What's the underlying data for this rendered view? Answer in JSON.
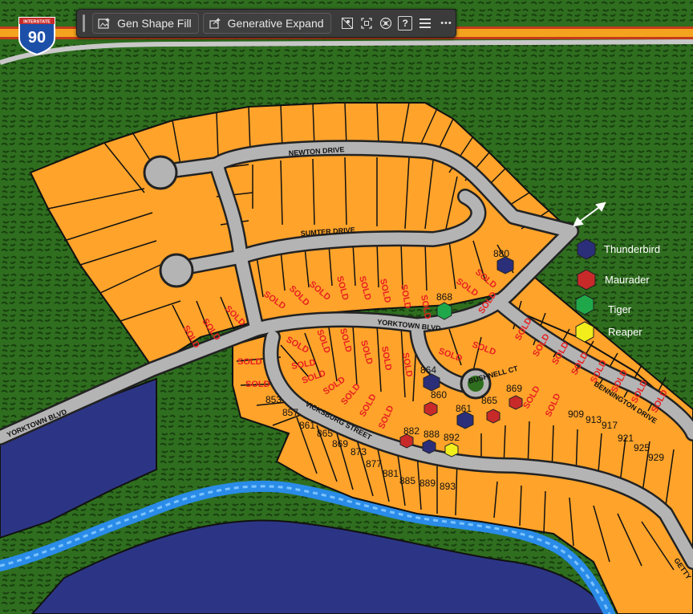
{
  "toolbar": {
    "gen_shape_fill": "Gen Shape Fill",
    "generative_expand": "Generative Expand",
    "help": "?",
    "more": "•••"
  },
  "shield": {
    "top": "INTERSTATE",
    "number": "90"
  },
  "streets": {
    "newton": "NEWTON DRIVE",
    "sumter": "SUMTER DRIVE",
    "yorktown": "YORKTOWN BLVD",
    "yorktown_sw": "YORKTOWN BLVD",
    "bushnell": "BUSHNELL CT",
    "bennington": "BENNINGTON DRIVE",
    "vicksburg": "VICKSBURG STREET",
    "gettysburg": "GETTY"
  },
  "sold": "SOLD",
  "lots": {
    "l880": "880",
    "l868": "868",
    "l864": "864",
    "l860": "860",
    "l861": "861",
    "l865": "865",
    "l869": "869",
    "l853": "853",
    "l857": "857",
    "l861b": "861",
    "l865b": "865",
    "l869b": "869",
    "l873": "873",
    "l877": "877",
    "l881": "881",
    "l885": "885",
    "l889": "889",
    "l893": "893",
    "l882": "882",
    "l888": "888",
    "l892": "892",
    "l909": "909",
    "l913": "913",
    "l917": "917",
    "l921": "921",
    "l925": "925",
    "l929": "929"
  },
  "legend": {
    "items": [
      {
        "label": "Thunderbird",
        "color": "#2b2f7a"
      },
      {
        "label": "Maurader",
        "color": "#c82a2a"
      },
      {
        "label": "Tiger",
        "color": "#1fa84a"
      },
      {
        "label": "Reaper",
        "color": "#f2ee1c"
      }
    ]
  },
  "colors": {
    "lot": "#ffa32a",
    "road": "#b4b4b4",
    "forest": "#2d6a1e",
    "water": "#2c3585",
    "river": "#2a8ce8",
    "sold": "#e82020"
  }
}
